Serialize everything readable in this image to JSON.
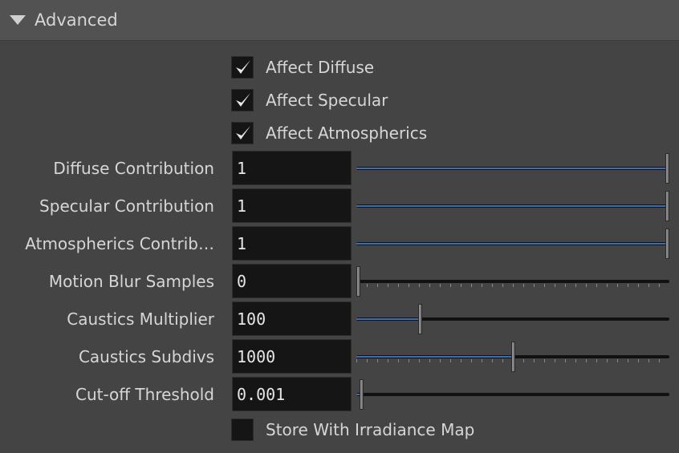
{
  "section": {
    "title": "Advanced"
  },
  "checkboxes": [
    {
      "label": "Affect Diffuse",
      "checked": true
    },
    {
      "label": "Affect Specular",
      "checked": true
    },
    {
      "label": "Affect Atmospherics",
      "checked": true
    },
    {
      "label": "Store With Irradiance Map",
      "checked": false
    }
  ],
  "params": [
    {
      "label": "Diffuse Contribution",
      "value": "1",
      "slider_fraction": 1.0,
      "ticks": false
    },
    {
      "label": "Specular Contribution",
      "value": "1",
      "slider_fraction": 1.0,
      "ticks": false
    },
    {
      "label": "Atmospherics Contrib…",
      "value": "1",
      "slider_fraction": 1.0,
      "ticks": false
    },
    {
      "label": "Motion Blur Samples",
      "value": "0",
      "slider_fraction": 0.0,
      "ticks": true
    },
    {
      "label": "Caustics Multiplier",
      "value": "100",
      "slider_fraction": 0.2,
      "ticks": false
    },
    {
      "label": "Caustics Subdivs",
      "value": "1000",
      "slider_fraction": 0.5,
      "ticks": true
    },
    {
      "label": "Cut-off Threshold",
      "value": "0.001",
      "slider_fraction": 0.01,
      "ticks": false
    }
  ],
  "colors": {
    "accent": "#3b6fb8",
    "panel_bg": "#444444",
    "header_bg": "#525252",
    "field_bg": "#151515"
  }
}
